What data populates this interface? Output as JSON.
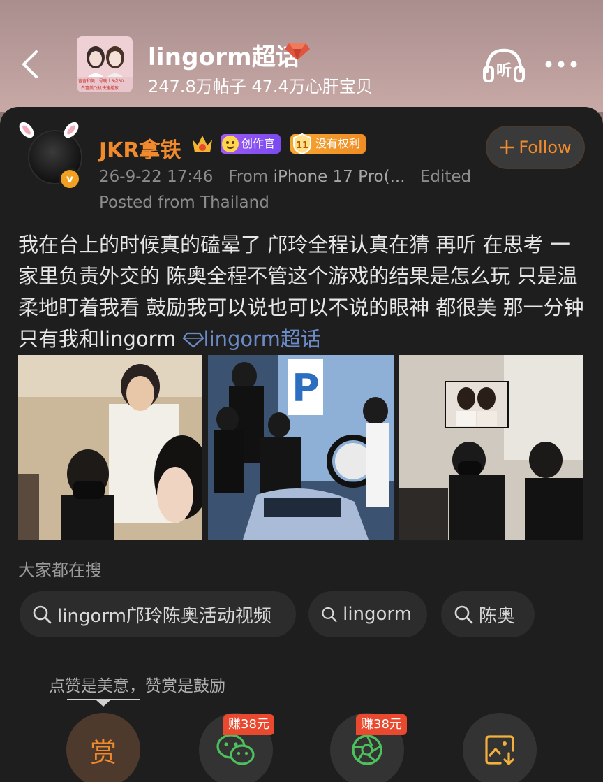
{
  "header": {
    "topic_title": "lingorm超话",
    "topic_stats": "247.8万帖子 47.4万心肝宝贝",
    "topic_thumb_banner": "吉吉和美...号晚上8点30",
    "topic_thumb_sub": "白富美飞机快速播放"
  },
  "post": {
    "username": "JKR拿铁",
    "creator_badge": "创作官",
    "rights_badge_level": "11",
    "rights_badge": "没有权利",
    "follow_label": "Follow",
    "timestamp": "26-9-22 17:46",
    "source_prefix": "From",
    "source": "iPhone 17 Pro(...",
    "edited": "Edited",
    "location": "Posted from Thailand",
    "text": "我在台上的时候真的磕晕了 邝玲全程认真在猜 再听 在思考 一家里负责外交的 陈奥全程不管这个游戏的结果是怎么玩 只是温柔地盯着我看 鼓励我可以说也可以不说的眼神 都很美 那一分钟 只有我和lingorm ",
    "topic_link": "lingorm超话"
  },
  "search": {
    "heading": "大家都在搜",
    "chips": [
      "lingorm邝玲陈奥活动视频",
      "lingorm",
      "陈奥"
    ]
  },
  "actions": {
    "tip": "点赞是美意，赞赏是鼓励",
    "reward_label": "赏",
    "earn_badge_1": "赚38元",
    "earn_badge_2": "赚38元"
  },
  "colors": {
    "accent": "#f08a2c",
    "link": "#6b8ac6",
    "card_bg": "#1e1e1e",
    "earn_badge": "#e8492f"
  }
}
